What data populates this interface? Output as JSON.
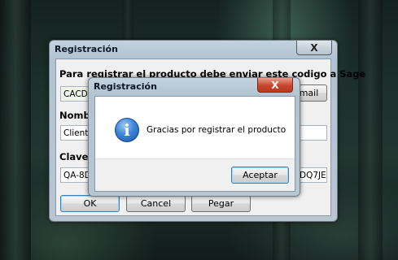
{
  "main_window": {
    "title": "Registración",
    "close_label": "X",
    "instruction": "Para registrar el producto debe enviar este codigo a Sage",
    "code_value": "CACDF",
    "mail_button_label": "mail",
    "name_label": "Nombre",
    "name_value": "Cliente S",
    "key_label": "Clave d",
    "key_value_left": "QA-8DE",
    "key_value_right": "DQ7JE",
    "ok_label": "OK",
    "cancel_label": "Cancel",
    "paste_label": "Pegar"
  },
  "dialog": {
    "title": "Registración",
    "close_label": "X",
    "icon": "info-icon",
    "icon_glyph": "i",
    "message": "Gracias por registrar el producto",
    "accept_label": "Aceptar"
  }
}
